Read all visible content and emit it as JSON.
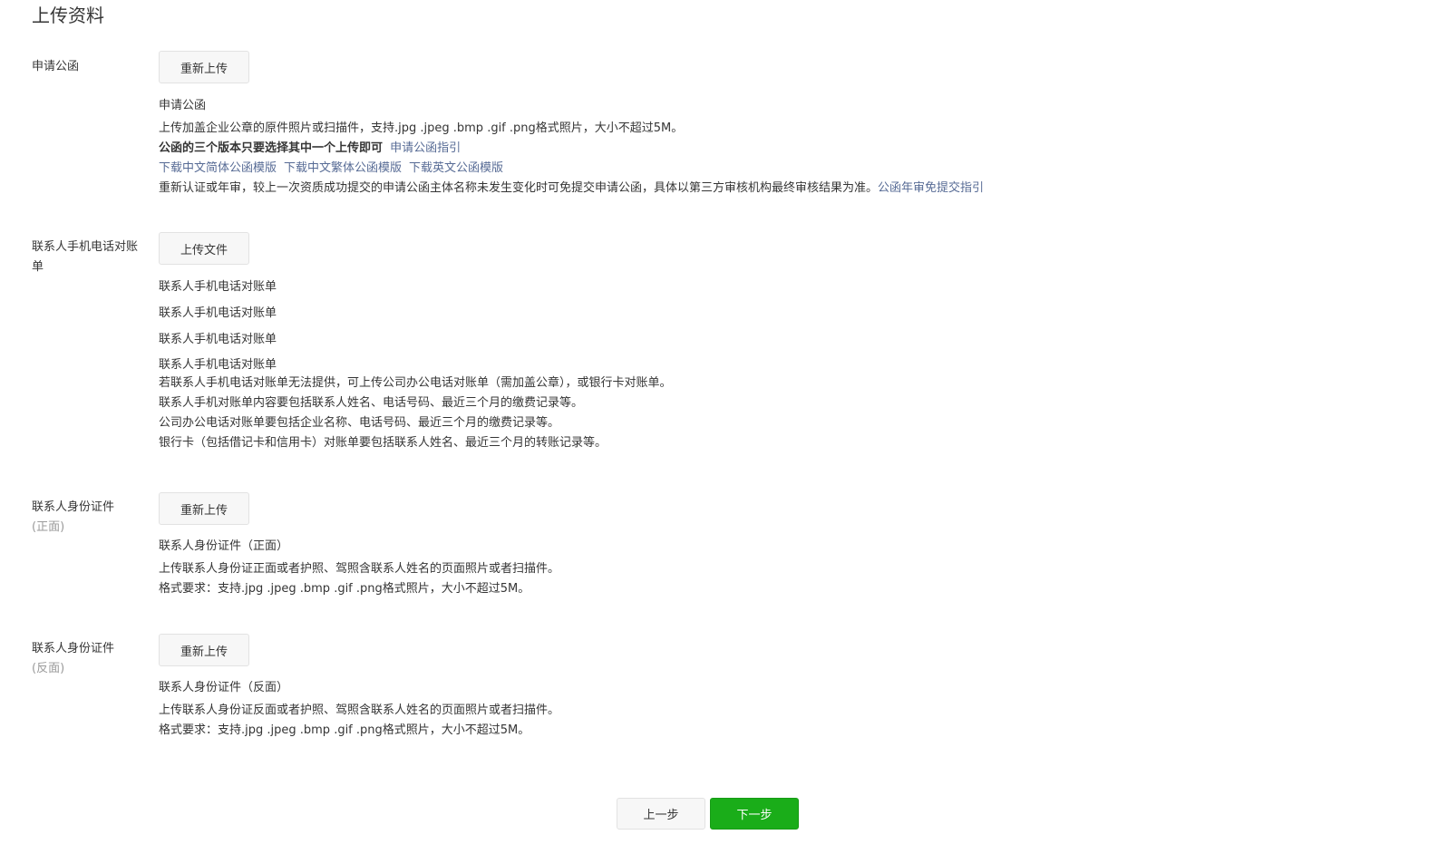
{
  "page": {
    "title": "上传资料"
  },
  "sections": {
    "letter": {
      "label": "申请公函",
      "button": "重新上传",
      "name": "申请公函",
      "desc": "上传加盖企业公章的原件照片或扫描件，支持.jpg .jpeg .bmp .gif .png格式照片，大小不超过5M。",
      "bold_note": "公函的三个版本只要选择其中一个上传即可",
      "guide_link": "申请公函指引",
      "download_links": [
        "下载中文简体公函模版",
        "下载中文繁体公函模版",
        "下载英文公函模版"
      ],
      "renew_note": "重新认证或年审，较上一次资质成功提交的申请公函主体名称未发生变化时可免提交申请公函，具体以第三方审核机构最终审核结果为准。",
      "renew_link": "公函年审免提交指引"
    },
    "phone_bill": {
      "label": "联系人手机电话对账单",
      "button": "上传文件",
      "file_lines": [
        "联系人手机电话对账单",
        "联系人手机电话对账单",
        "联系人手机电话对账单",
        "联系人手机电话对账单"
      ],
      "notes": [
        "若联系人手机电话对账单无法提供，可上传公司办公电话对账单（需加盖公章），或银行卡对账单。",
        "联系人手机对账单内容要包括联系人姓名、电话号码、最近三个月的缴费记录等。",
        "公司办公电话对账单要包括企业名称、电话号码、最近三个月的缴费记录等。",
        "银行卡（包括借记卡和信用卡）对账单要包括联系人姓名、最近三个月的转账记录等。"
      ]
    },
    "id_front": {
      "label": "联系人身份证件",
      "label_sub": "(正面)",
      "button": "重新上传",
      "name": "联系人身份证件（正面）",
      "desc": "上传联系人身份证正面或者护照、驾照含联系人姓名的页面照片或者扫描件。",
      "format": "格式要求：支持.jpg .jpeg .bmp .gif .png格式照片，大小不超过5M。"
    },
    "id_back": {
      "label": "联系人身份证件",
      "label_sub": "(反面)",
      "button": "重新上传",
      "name": "联系人身份证件（反面）",
      "desc": "上传联系人身份证反面或者护照、驾照含联系人姓名的页面照片或者扫描件。",
      "format": "格式要求：支持.jpg .jpeg .bmp .gif .png格式照片，大小不超过5M。"
    }
  },
  "footer": {
    "prev": "上一步",
    "next": "下一步"
  },
  "colors": {
    "link": "#576b95",
    "primary": "#1aad19",
    "text": "#353535",
    "muted": "#9a9a9a"
  }
}
